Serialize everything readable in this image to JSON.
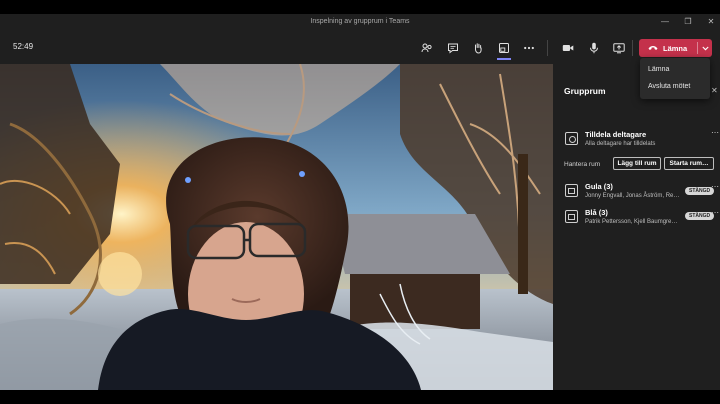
{
  "window": {
    "title": "Inspelning av grupprum i Teams",
    "controls": [
      "—",
      "❐",
      "✕"
    ]
  },
  "toolbar": {
    "timer": "52:49",
    "buttons": [
      {
        "name": "breakout-rooms-icon"
      },
      {
        "name": "chat-icon"
      },
      {
        "name": "raise-hand-icon"
      },
      {
        "name": "rooms-icon"
      },
      {
        "name": "more-options-icon"
      },
      {
        "name": "camera-icon"
      },
      {
        "name": "microphone-icon"
      },
      {
        "name": "share-screen-icon"
      }
    ],
    "leave_label": "Lämna",
    "leave_color": "#c4314b"
  },
  "leave_menu": {
    "items": [
      "Lämna",
      "Avsluta mötet"
    ]
  },
  "panel": {
    "title": "Grupprum",
    "assign_title": "Tilldela deltagare",
    "assign_subtitle": "Alla deltagare har tilldelats",
    "manage_label": "Hantera rum",
    "add_room_label": "Lägg till rum",
    "start_rooms_label": "Starta rum…",
    "rooms": [
      {
        "name": "Gula (3)",
        "people": "Jonny Engvall, Jonas Åström, Re…",
        "status": "STÄNGD"
      },
      {
        "name": "Blå (3)",
        "people": "Patrik Pettersson, Kjell Baumgre…",
        "status": "STÄNGD"
      }
    ]
  }
}
